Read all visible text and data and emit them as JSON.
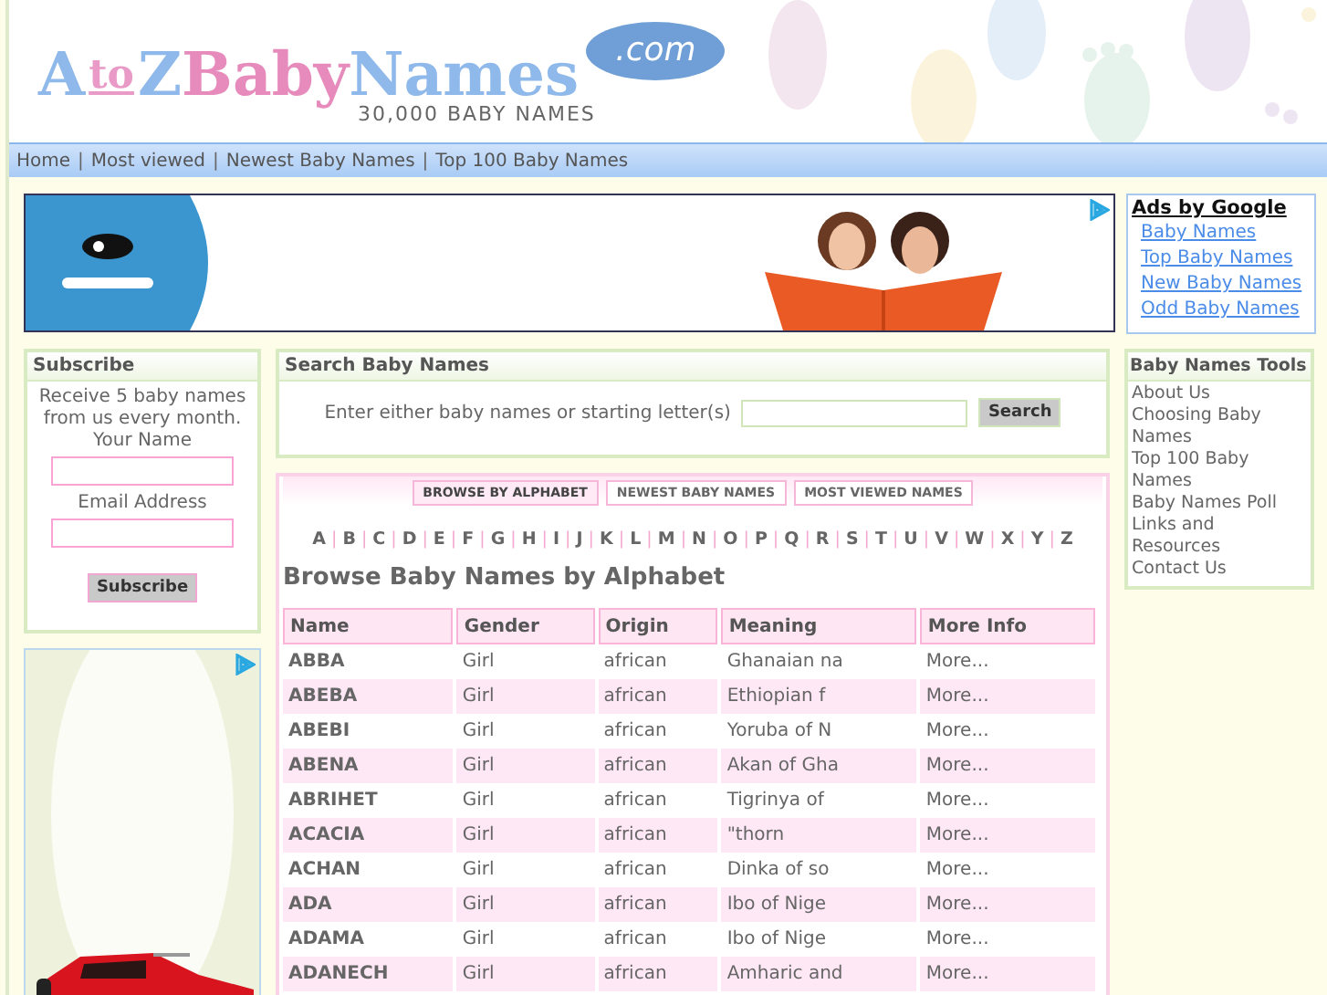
{
  "header": {
    "logo": {
      "a": "A",
      "to": "to",
      "z": "Z",
      "baby": "Baby",
      "names": "Names",
      "com": ".com"
    },
    "tagline": "30,000 BABY NAMES"
  },
  "nav": {
    "separator": "|",
    "links": [
      "Home",
      "Most viewed",
      "Newest Baby Names",
      "Top 100 Baby Names"
    ]
  },
  "google_ads": {
    "title": "Ads by Google",
    "links": [
      "Baby Names",
      "Top Baby Names",
      "New Baby Names",
      "Odd Baby Names"
    ]
  },
  "subscribe": {
    "title": "Subscribe",
    "text": "Receive 5 baby names from us every month.",
    "name_label": "Your Name",
    "email_label": "Email Address",
    "button": "Subscribe"
  },
  "search": {
    "title": "Search Baby Names",
    "prompt": "Enter either baby names or starting letter(s)",
    "button": "Search"
  },
  "browse": {
    "tabs": [
      {
        "label": "BROWSE BY ALPHABET",
        "selected": true
      },
      {
        "label": "NEWEST BABY NAMES",
        "selected": false
      },
      {
        "label": "MOST VIEWED NAMES",
        "selected": false
      }
    ],
    "letter_separator": "|",
    "letters": [
      "A",
      "B",
      "C",
      "D",
      "E",
      "F",
      "G",
      "H",
      "I",
      "J",
      "K",
      "L",
      "M",
      "N",
      "O",
      "P",
      "Q",
      "R",
      "S",
      "T",
      "U",
      "V",
      "W",
      "X",
      "Y",
      "Z"
    ],
    "heading": "Browse Baby Names by Alphabet",
    "columns": [
      "Name",
      "Gender",
      "Origin",
      "Meaning",
      "More Info"
    ],
    "rows": [
      [
        "ABBA",
        "Girl",
        "african",
        "Ghanaian na",
        "More..."
      ],
      [
        "ABEBA",
        "Girl",
        "african",
        "Ethiopian f",
        "More..."
      ],
      [
        "ABEBI",
        "Girl",
        "african",
        "Yoruba of N",
        "More..."
      ],
      [
        "ABENA",
        "Girl",
        "african",
        "Akan of Gha",
        "More..."
      ],
      [
        "ABRIHET",
        "Girl",
        "african",
        "Tigrinya of",
        "More..."
      ],
      [
        "ACACIA",
        "Girl",
        "african",
        "\"thorn",
        "More..."
      ],
      [
        "ACHAN",
        "Girl",
        "african",
        "Dinka of so",
        "More..."
      ],
      [
        "ADA",
        "Girl",
        "african",
        "Ibo of Nige",
        "More..."
      ],
      [
        "ADAMA",
        "Girl",
        "african",
        "Ibo of Nige",
        "More..."
      ],
      [
        "ADANECH",
        "Girl",
        "african",
        "Amharic and",
        "More..."
      ]
    ]
  },
  "tools": {
    "title": "Baby Names Tools",
    "links": [
      "About Us",
      "Choosing Baby Names",
      "Top 100 Baby Names",
      "Baby Names Poll",
      "Links and Resources",
      "Contact Us"
    ]
  }
}
